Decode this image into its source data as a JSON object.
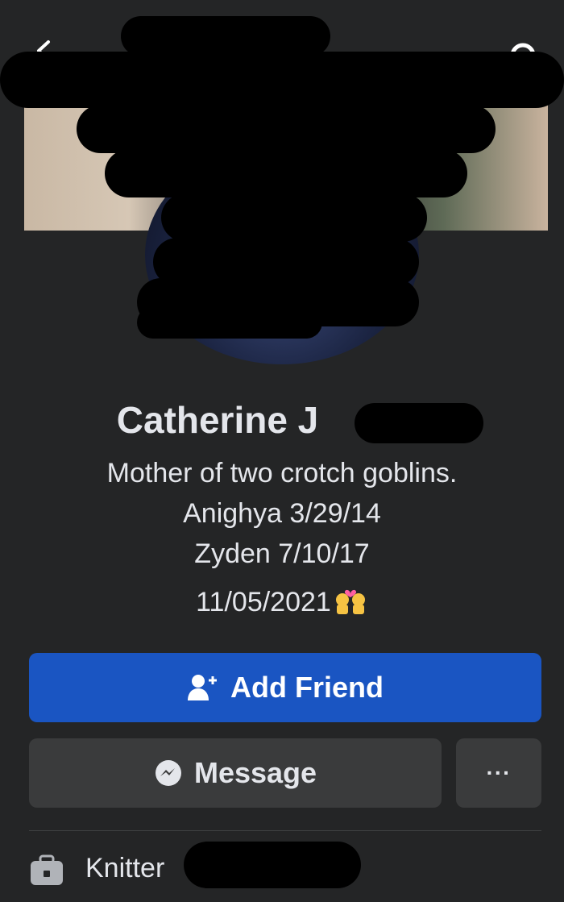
{
  "header": {
    "back_icon": "chevron-left-icon",
    "search_icon": "search-icon"
  },
  "profile": {
    "name": "Catherine J",
    "bio_lines": [
      "Mother of two crotch goblins.",
      "Anighya 3/29/14",
      "Zyden 7/10/17",
      "11/05/2021"
    ],
    "bio_emoji": "people-with-heart-icon"
  },
  "actions": {
    "add_friend_label": "Add Friend",
    "message_label": "Message",
    "more_label": "···"
  },
  "details": {
    "work_label": "Knitter",
    "work_icon": "briefcase-icon"
  },
  "colors": {
    "background": "#242526",
    "primary_button": "#1a55c2",
    "secondary_button": "#3a3b3c"
  }
}
